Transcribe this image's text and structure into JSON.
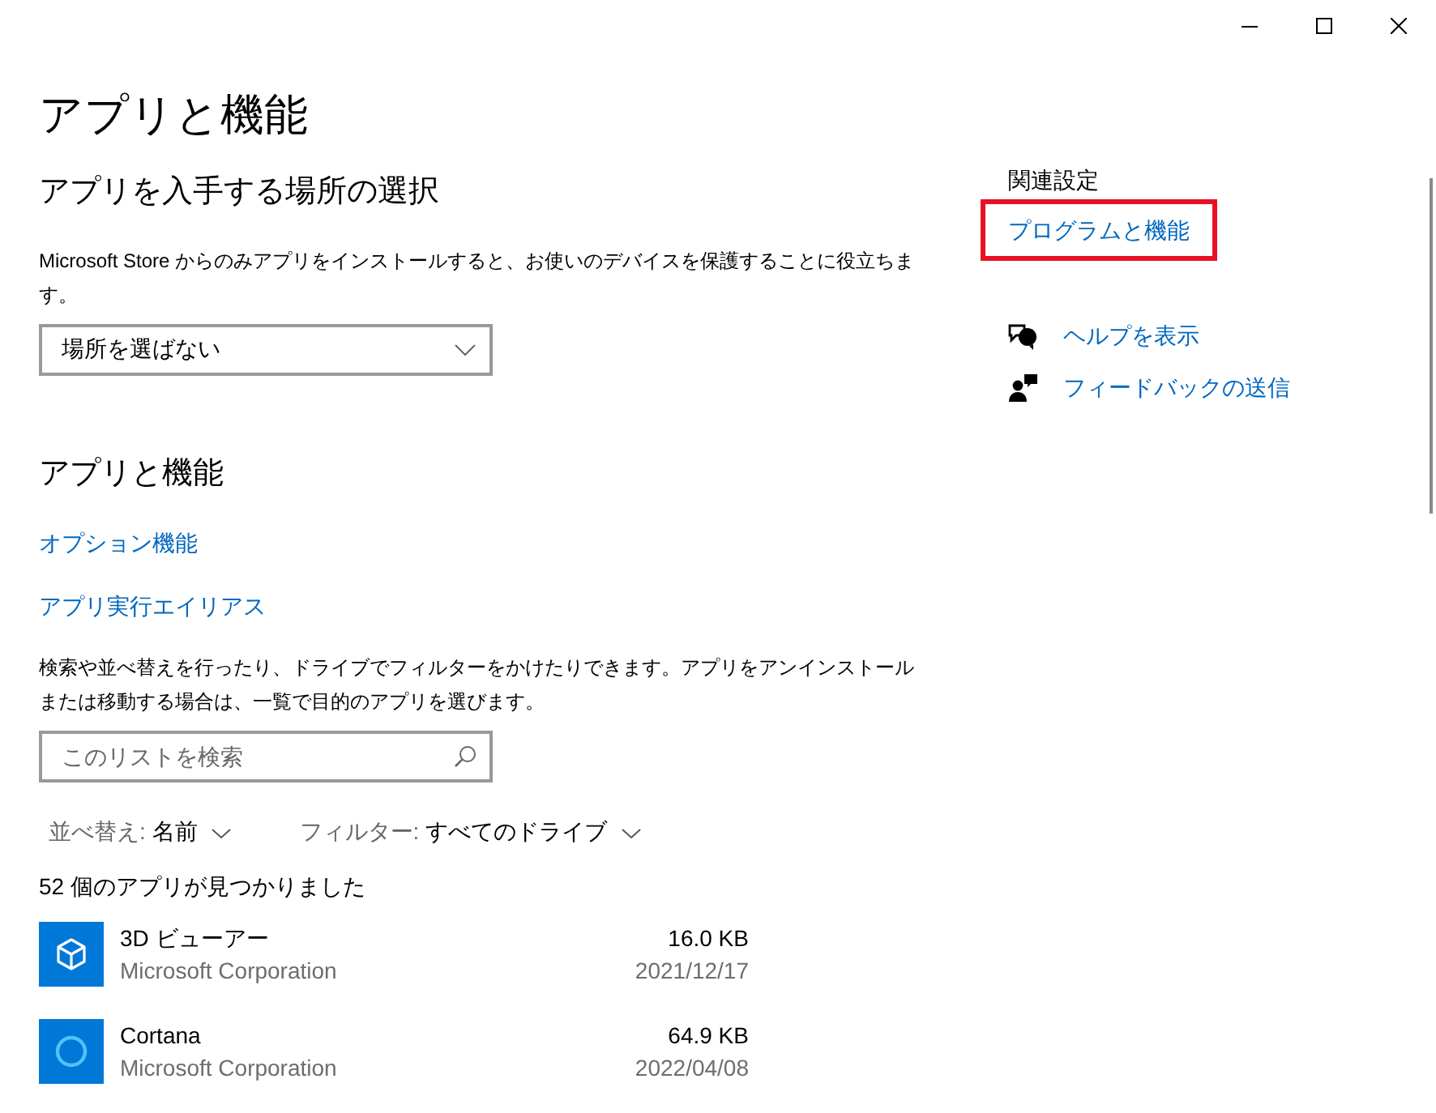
{
  "window": {
    "controls": [
      {
        "kind": "minimize"
      },
      {
        "kind": "maximize"
      },
      {
        "kind": "close"
      }
    ]
  },
  "title": "アプリと機能",
  "install_source": {
    "heading": "アプリを入手する場所の選択",
    "description": "Microsoft Store からのみアプリをインストールすると、お使いのデバイスを保護することに役立ちます。",
    "dropdown": {
      "value": "場所を選ばない"
    }
  },
  "apps_section": {
    "heading": "アプリと機能",
    "links": [
      "オプション機能",
      "アプリ実行エイリアス"
    ],
    "description": "検索や並べ替えを行ったり、ドライブでフィルターをかけたりできます。アプリをアンインストールまたは移動する場合は、一覧で目的のアプリを選びます。",
    "search": {
      "placeholder": "このリストを検索"
    },
    "sort": {
      "label": "並べ替え:",
      "value": "名前"
    },
    "filter": {
      "label": "フィルター:",
      "value": "すべてのドライブ"
    },
    "count": "52 個のアプリが見つかりました",
    "apps": [
      {
        "name": "3D ビューアー",
        "publisher": "Microsoft Corporation",
        "size": "16.0 KB",
        "date": "2021/12/17",
        "kind": "cube"
      },
      {
        "name": "Cortana",
        "publisher": "Microsoft Corporation",
        "size": "64.9 KB",
        "date": "2022/04/08",
        "kind": "ring"
      }
    ]
  },
  "related": {
    "heading": "関連設定",
    "links": [
      {
        "label": "プログラムと機能",
        "highlighted": true
      }
    ]
  },
  "help_links": [
    {
      "label": "ヘルプを表示",
      "kind": "help"
    },
    {
      "label": "フィードバックの送信",
      "kind": "feedback"
    }
  ]
}
